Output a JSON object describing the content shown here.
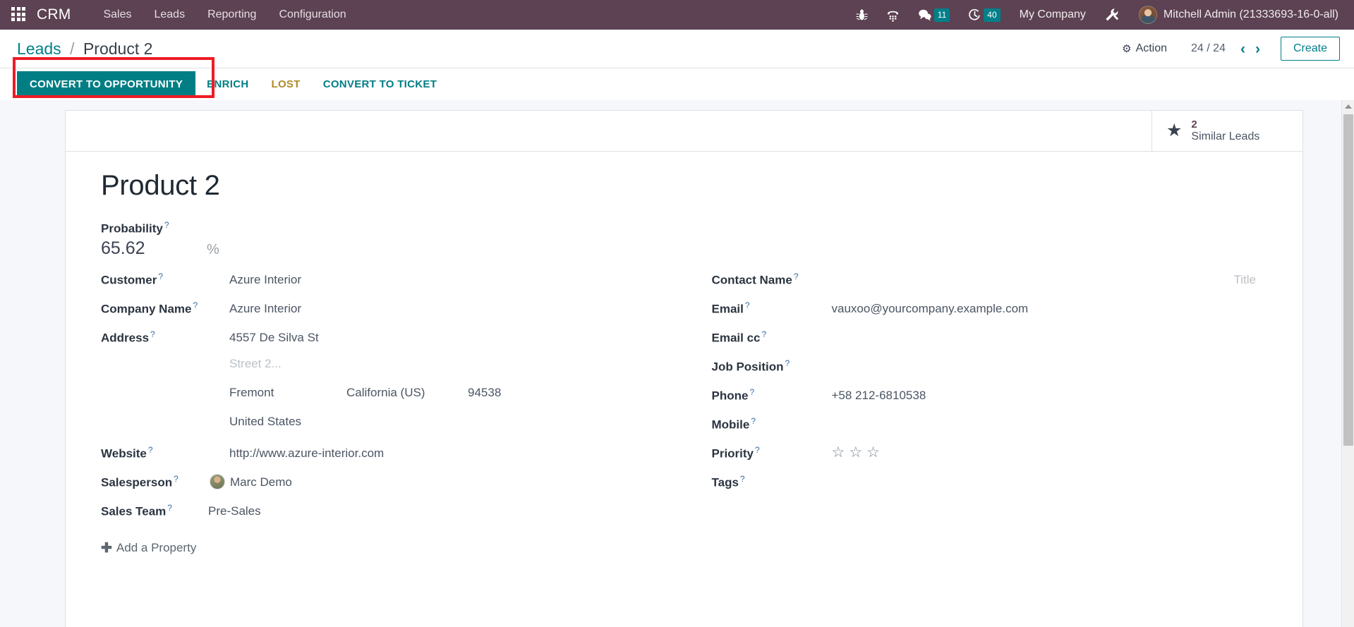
{
  "topbar": {
    "apps_icon": "apps-grid-icon",
    "brand": "CRM",
    "menus": [
      {
        "label": "Sales"
      },
      {
        "label": "Leads"
      },
      {
        "label": "Reporting"
      },
      {
        "label": "Configuration"
      }
    ],
    "sys_icons": [
      {
        "name": "bug-icon",
        "glyph": "ὁB"
      },
      {
        "name": "dialpad-icon",
        "glyph": ""
      },
      {
        "name": "messages-icon",
        "glyph": "",
        "badge": "11"
      },
      {
        "name": "activities-clock-icon",
        "glyph": "",
        "badge": "40"
      }
    ],
    "messages_badge": "11",
    "activities_badge": "40",
    "company": "My Company",
    "tools_icon": "tools-wrench-icon",
    "user": "Mitchell Admin (21333693-16-0-all)"
  },
  "controlpanel": {
    "breadcrumb_root": "Leads",
    "breadcrumb_sep": "/",
    "breadcrumb_current": "Product 2",
    "action_label": "Action",
    "gear_glyph": "⚙",
    "pager": "24 / 24",
    "prev_glyph": "‹",
    "next_glyph": "›",
    "create_label": "Create"
  },
  "statusbar": {
    "primary": "CONVERT TO OPPORTUNITY",
    "buttons": [
      {
        "label": "ENRICH",
        "style": "link"
      },
      {
        "label": "LOST",
        "style": "warn"
      },
      {
        "label": "CONVERT TO TICKET",
        "style": "link"
      }
    ],
    "highlight_target": "CONVERT TO OPPORTUNITY"
  },
  "statbutton": {
    "icon": "star-filled-icon",
    "star_glyph": "★",
    "count": "2",
    "label": "Similar Leads"
  },
  "record": {
    "title": "Product 2",
    "probability": {
      "label": "Probability",
      "value": "65.62",
      "suffix": "%"
    },
    "left_fields": [
      {
        "label": "Customer",
        "value": "Azure Interior"
      },
      {
        "label": "Company Name",
        "value": "Azure Interior"
      }
    ],
    "address": {
      "label": "Address",
      "street": "4557 De Silva St",
      "street2_placeholder": "Street 2...",
      "city": "Fremont",
      "state": "California (US)",
      "zip": "94538",
      "country": "United States"
    },
    "website": {
      "label": "Website",
      "value": "http://www.azure-interior.com"
    },
    "salesperson": {
      "label": "Salesperson",
      "value": "Marc Demo"
    },
    "salesteam": {
      "label": "Sales Team",
      "value": "Pre-Sales"
    },
    "add_property": "Add a Property",
    "add_property_glyph": "✚",
    "right_fields": {
      "contact_name": {
        "label": "Contact Name",
        "value": "",
        "title_placeholder": "Title"
      },
      "email": {
        "label": "Email",
        "value": "vauxoo@yourcompany.example.com"
      },
      "email_cc": {
        "label": "Email cc",
        "value": ""
      },
      "job_position": {
        "label": "Job Position",
        "value": ""
      },
      "phone": {
        "label": "Phone",
        "value": "+58 212-6810538"
      },
      "mobile": {
        "label": "Mobile",
        "value": ""
      },
      "priority": {
        "label": "Priority",
        "stars_total": 3,
        "stars_filled": 0,
        "star_glyph": "☆"
      },
      "tags": {
        "label": "Tags",
        "value": ""
      }
    }
  },
  "colors": {
    "brand_purple": "#5c4252",
    "accent_teal": "#00808a",
    "warn_amber": "#b08a28",
    "highlight_red": "#ee1c25"
  }
}
